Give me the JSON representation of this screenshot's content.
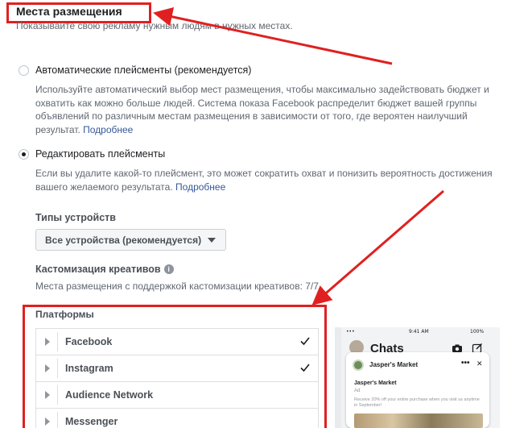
{
  "header": {
    "title": "Места размещения",
    "subtitle": "Показывайте свою рекламу нужным людям в нужных местах."
  },
  "options": [
    {
      "label": "Автоматические плейсменты (рекомендуется)",
      "selected": false,
      "description": "Используйте автоматический выбор мест размещения, чтобы максимально задействовать бюджет и охватить как можно больше людей. Система показа Facebook распределит бюджет вашей группы объявлений по различным местам размещения в зависимости от того, где вероятен наилучший результат.",
      "link": "Подробнее"
    },
    {
      "label": "Редактировать плейсменты",
      "selected": true,
      "description": "Если вы удалите какой-то плейсмент, это может сократить охват и понизить вероятность достижения вашего желаемого результата.",
      "link": "Подробнее"
    }
  ],
  "device_types": {
    "label": "Типы устройств",
    "value": "Все устройства (рекомендуется)"
  },
  "creative_customization": {
    "label": "Кастомизация креативов",
    "description": "Места размещения с поддержкой кастомизации креативов: 7/7"
  },
  "platforms": {
    "label": "Платформы",
    "items": [
      {
        "name": "Facebook",
        "checked": true
      },
      {
        "name": "Instagram",
        "checked": true
      },
      {
        "name": "Audience Network",
        "checked": false
      },
      {
        "name": "Messenger",
        "checked": false
      }
    ]
  },
  "preview": {
    "status_left": "•••",
    "status_time": "9:41 AM",
    "status_battery": "100%",
    "chats_title": "Chats",
    "advertiser": "Jasper's Market",
    "ad_title": "Jasper's Market",
    "ad_label": "Ad",
    "ad_body": "Receive 20% off your entire purchase when you visit us anytime in September!",
    "menu_dots": "•••",
    "close": "✕"
  },
  "colors": {
    "annotation_red": "#e02020",
    "link_blue": "#365899"
  }
}
